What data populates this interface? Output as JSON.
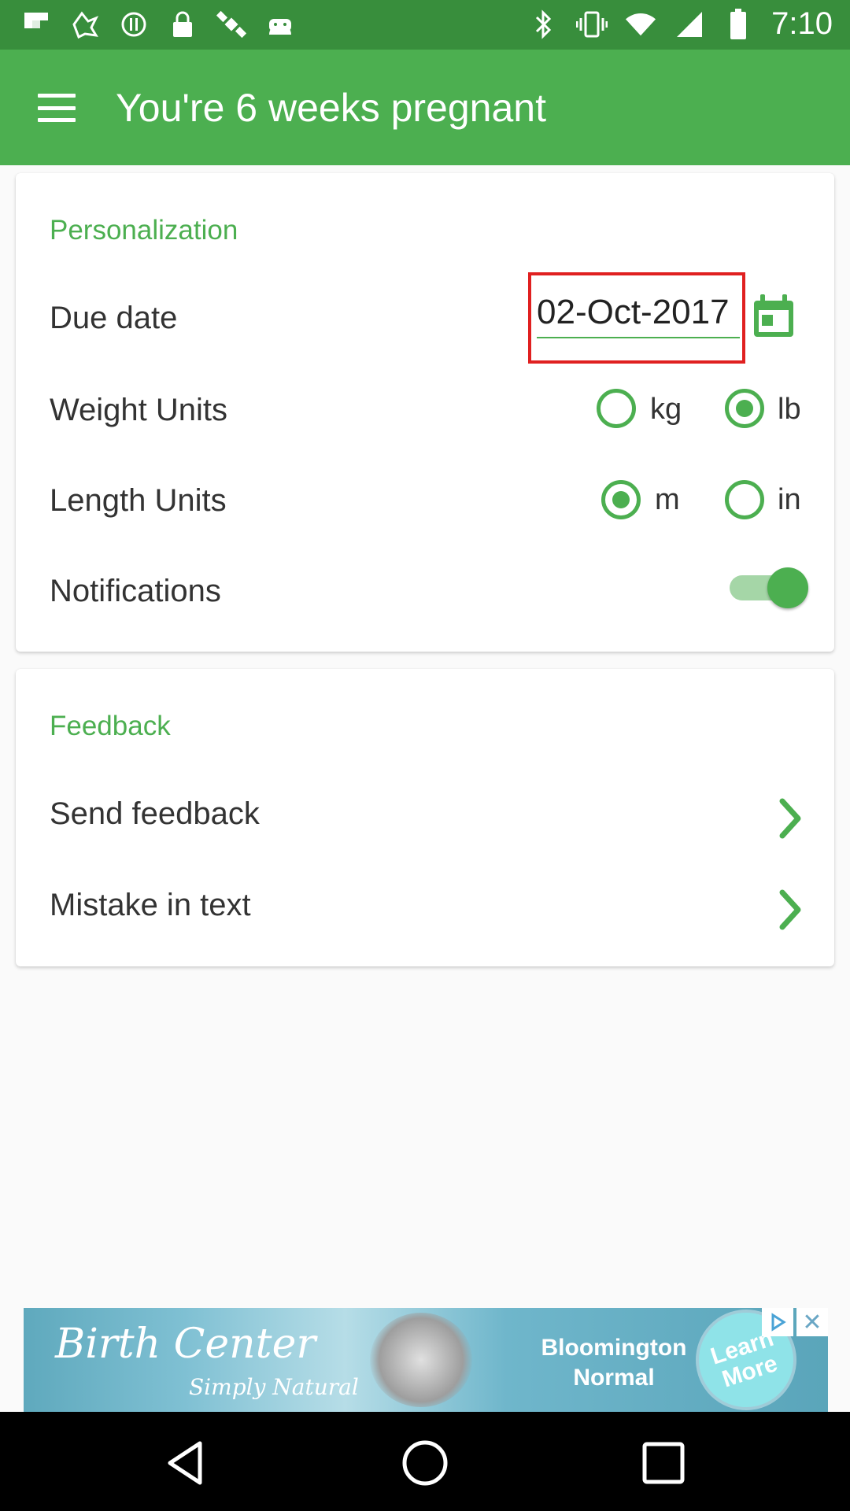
{
  "status_bar": {
    "time": "7:10",
    "left_icons": [
      "flipboard-icon",
      "hootsuite-icon",
      "hourglass-icon",
      "lock-icon",
      "satellite-icon",
      "android-icon"
    ],
    "right_icons": [
      "bluetooth-icon",
      "vibrate-icon",
      "wifi-icon",
      "signal-icon",
      "battery-icon"
    ]
  },
  "app_bar": {
    "title": "You're 6 weeks pregnant",
    "menu_icon": "hamburger-menu-icon"
  },
  "personalization": {
    "section_title": "Personalization",
    "due_date_label": "Due date",
    "due_date_value": "02-Oct-2017",
    "weight_label": "Weight Units",
    "weight_options": [
      {
        "label": "kg",
        "checked": false
      },
      {
        "label": "lb",
        "checked": true
      }
    ],
    "length_label": "Length Units",
    "length_options": [
      {
        "label": "m",
        "checked": true
      },
      {
        "label": "in",
        "checked": false
      }
    ],
    "notifications_label": "Notifications",
    "notifications_on": true
  },
  "feedback": {
    "section_title": "Feedback",
    "items": [
      {
        "label": "Send feedback"
      },
      {
        "label": "Mistake in text"
      }
    ]
  },
  "ad": {
    "brand": "Birth Center",
    "tagline": "Simply Natural",
    "location_line1": "Bloomington",
    "location_line2": "Normal",
    "cta": "Learn More",
    "close": "✕"
  },
  "colors": {
    "accent": "#4caf50",
    "status_bar": "#388e3c",
    "highlight_box": "#e02020"
  }
}
